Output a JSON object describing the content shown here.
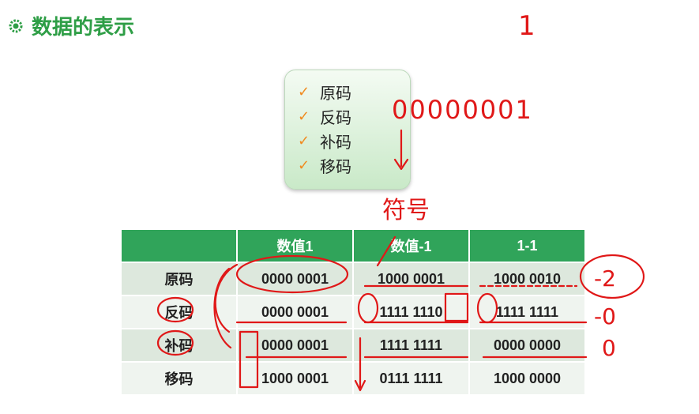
{
  "header": {
    "title": "数据的表示",
    "icon": "gear-icon"
  },
  "code_list": {
    "items": [
      "原码",
      "反码",
      "补码",
      "移码"
    ],
    "check_color": "#f08a1f"
  },
  "table": {
    "columns": [
      "",
      "数值1",
      "数值-1",
      "1-1"
    ],
    "rows": [
      {
        "label": "原码",
        "values": [
          "0000 0001",
          "1000 0001",
          "1000 0010"
        ]
      },
      {
        "label": "反码",
        "values": [
          "0000 0001",
          "1111 1110",
          "1111 1111"
        ]
      },
      {
        "label": "补码",
        "values": [
          "0000 0001",
          "1111 1111",
          "0000 0000"
        ]
      },
      {
        "label": "移码",
        "values": [
          "1000 0001",
          "0111 1111",
          "1000 0000"
        ]
      }
    ],
    "header_color": "#30a45a"
  },
  "annotations": {
    "top_digit": "1",
    "binary": "00000001",
    "sign_note": "符号",
    "results": [
      "-2",
      "-0",
      "0"
    ],
    "ink_color": "#e01818"
  }
}
